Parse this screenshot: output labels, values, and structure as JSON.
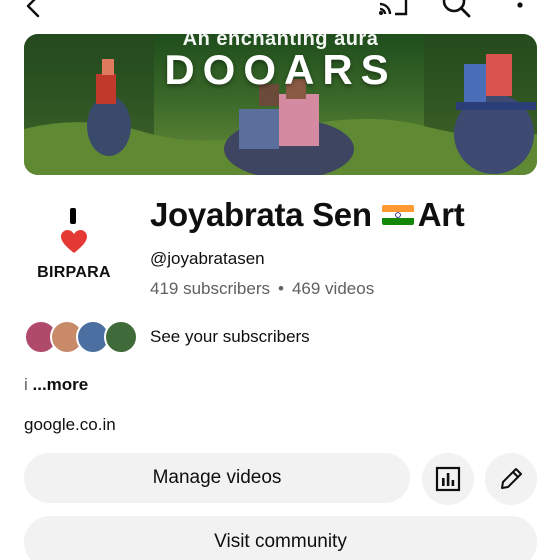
{
  "toolbar": {
    "back_icon": "back-arrow-icon",
    "cast_icon": "cast-icon",
    "search_icon": "search-icon",
    "more_icon": "more-vert-icon"
  },
  "banner": {
    "subtitle": "An enchanting aura",
    "title": "DOOARS"
  },
  "avatar": {
    "text": "BIRPARA",
    "heart_color": "#e53935"
  },
  "channel": {
    "name": "Joyabrata Sen",
    "name_suffix": "Art",
    "handle": "@joyabratasen",
    "subscribers": "419 subscribers",
    "separator": "•",
    "videos": "469 videos"
  },
  "subscribers_row": {
    "label": "See your subscribers"
  },
  "description": {
    "prefix": "i",
    "more": "...more"
  },
  "link": {
    "text": "google.co.in"
  },
  "buttons": {
    "manage": "Manage videos",
    "analytics_icon": "analytics-icon",
    "edit_icon": "edit-pencil-icon",
    "community": "Visit community"
  }
}
